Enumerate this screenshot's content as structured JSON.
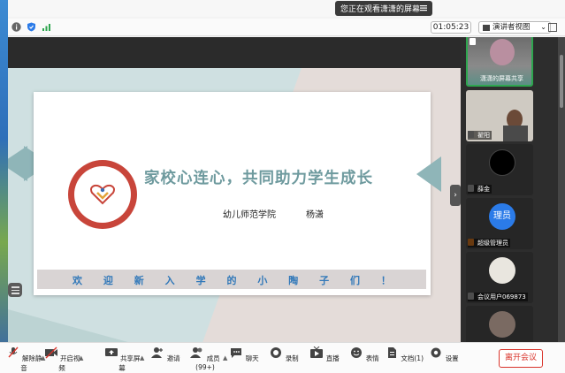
{
  "app": {
    "banner": "您正在观看潇潇的屏幕"
  },
  "topbar": {
    "timer": "01:05:23",
    "view_label": "演讲者视图"
  },
  "slide": {
    "title": "家校心连心，共同助力学生成长",
    "college": "幼儿师范学院",
    "presenter": "杨潇",
    "welcome_chars": [
      "欢",
      "迎",
      "新",
      "入",
      "学",
      "的",
      "小",
      "陶",
      "子",
      "们",
      "！"
    ]
  },
  "participants": [
    {
      "name": "潇潇的屏幕共享"
    },
    {
      "name": "翟阳"
    },
    {
      "name": "薛金"
    },
    {
      "name": "超级管理员",
      "avatar_text": "理员",
      "avatar_color": "#2b7be8"
    },
    {
      "name": "会议用户069873"
    }
  ],
  "toolbar": {
    "mute": "解除静音",
    "video": "开启视频",
    "share": "共享屏幕",
    "invite": "邀请",
    "members": "成员(99+)",
    "chat": "聊天",
    "record": "录制",
    "live": "直播",
    "emoji": "表情",
    "docs": "文档(1)",
    "settings": "设置",
    "leave": "离开会议"
  },
  "colors": {
    "accent_green": "#2ea64f",
    "leave_red": "#d9342b",
    "slide_teal": "#6e9a9e",
    "welcome_blue": "#3178b9"
  }
}
